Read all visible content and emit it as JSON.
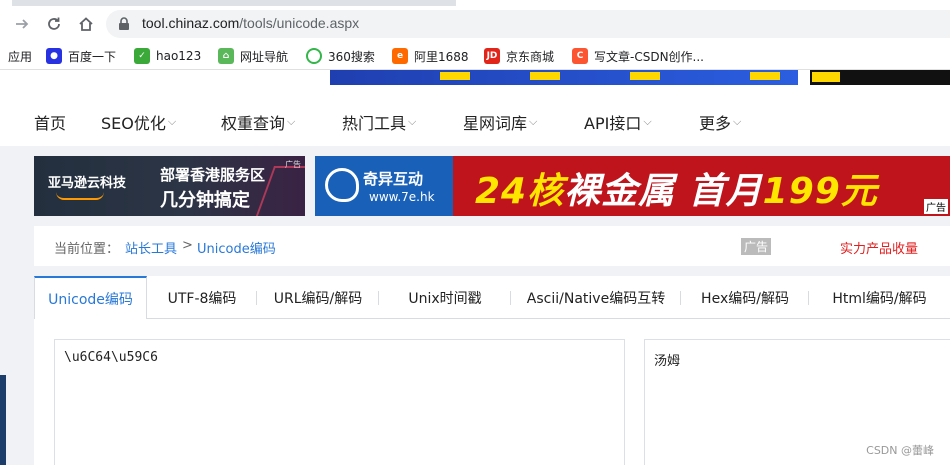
{
  "browser": {
    "url_host": "tool.chinaz.com",
    "url_path": "/tools/unicode.aspx",
    "bookmarks": [
      "应用",
      "百度一下",
      "hao123",
      "网址导航",
      "360搜索",
      "阿里1688",
      "京东商城",
      "写文章-CSDN创作..."
    ]
  },
  "nav": {
    "items": [
      "首页",
      "SEO优化",
      "权重查询",
      "热门工具",
      "星网词库",
      "API接口",
      "更多"
    ]
  },
  "ads": {
    "ad1_brand": "亚马逊云科技",
    "ad1_line1": "部署香港服务区",
    "ad1_line2": "几分钟搞定",
    "ad1_tag": "广告",
    "ad2_brand": "奇异互动",
    "ad2_url": "www.7e.hk",
    "ad2_text_a": "24核",
    "ad2_text_b": "裸金属  首月",
    "ad2_text_c": "199元",
    "ad2_tag": "广告"
  },
  "breadcrumb": {
    "label": "当前位置：",
    "home": "站长工具",
    "sep": ">",
    "current": "Unicode编码",
    "ad_tag": "广告",
    "promo": "实力产品收量"
  },
  "tabs": [
    "Unicode编码",
    "UTF-8编码",
    "URL编码/解码",
    "Unix时间戳",
    "Ascii/Native编码互转",
    "Hex编码/解码",
    "Html编码/解码"
  ],
  "editor": {
    "input_value": "\\u6C64\\u59C6",
    "output_value": "汤姆"
  },
  "watermark": "CSDN @蕾峰",
  "colors": {
    "accent": "#2878d8",
    "promo": "#e02020"
  }
}
